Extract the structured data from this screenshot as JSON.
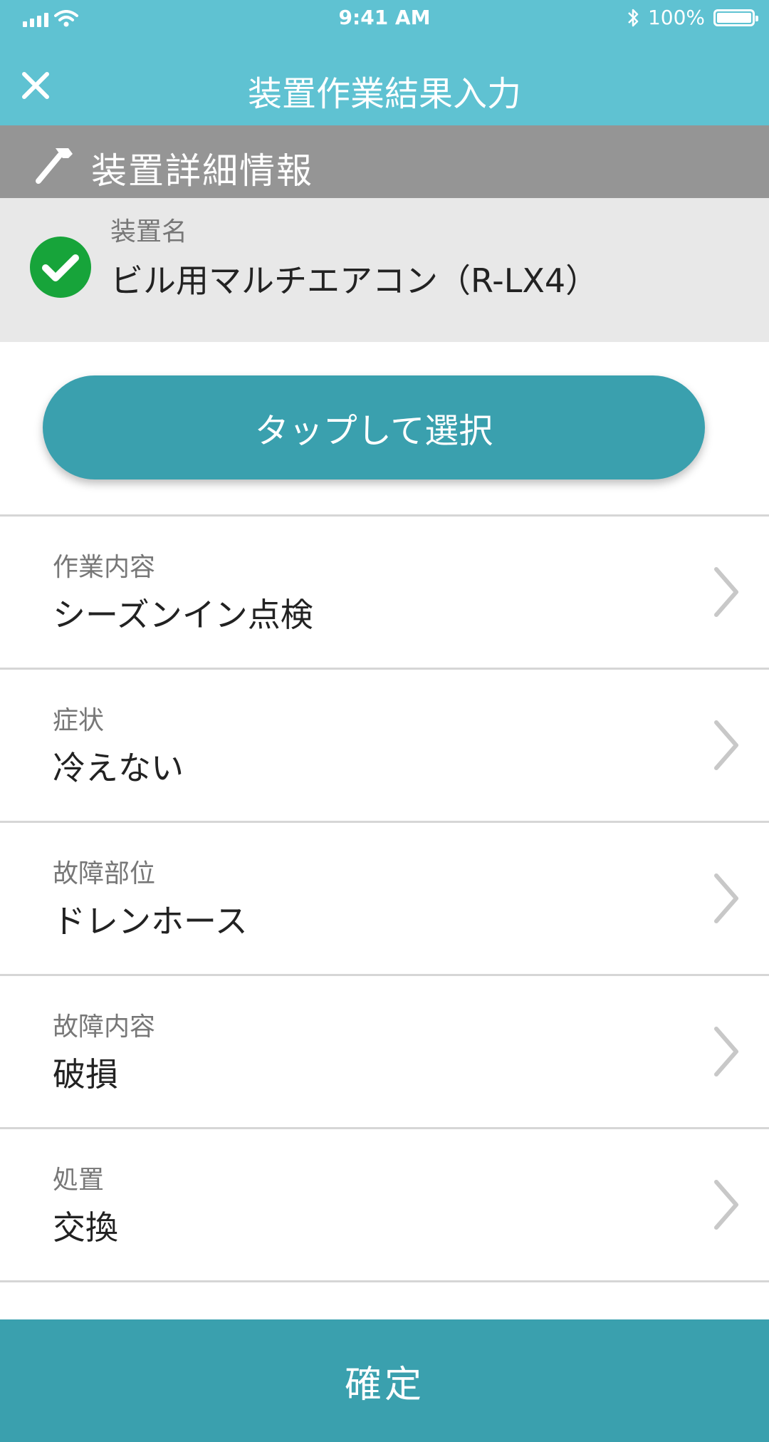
{
  "status_bar": {
    "time": "9:41 AM",
    "battery": "100%"
  },
  "nav": {
    "title": "装置作業結果入力",
    "close_icon": "close-icon"
  },
  "section": {
    "title": "装置詳細情報",
    "icon": "hammer-icon"
  },
  "device": {
    "label": "装置名",
    "value": "ビル用マルチエアコン（R-LX4）",
    "status_icon": "check-circle-icon",
    "status_color": "#17a43a"
  },
  "select_button": {
    "label": "タップして選択"
  },
  "rows": [
    {
      "label": "作業内容",
      "value": "シーズンイン点検"
    },
    {
      "label": "症状",
      "value": "冷えない"
    },
    {
      "label": "故障部位",
      "value": "ドレンホース"
    },
    {
      "label": "故障内容",
      "value": "破損"
    },
    {
      "label": "処置",
      "value": "交換"
    }
  ],
  "confirm_button": {
    "label": "確定"
  },
  "colors": {
    "header": "#5fc2d2",
    "accent": "#3aa0ae",
    "section_header": "#959595"
  }
}
